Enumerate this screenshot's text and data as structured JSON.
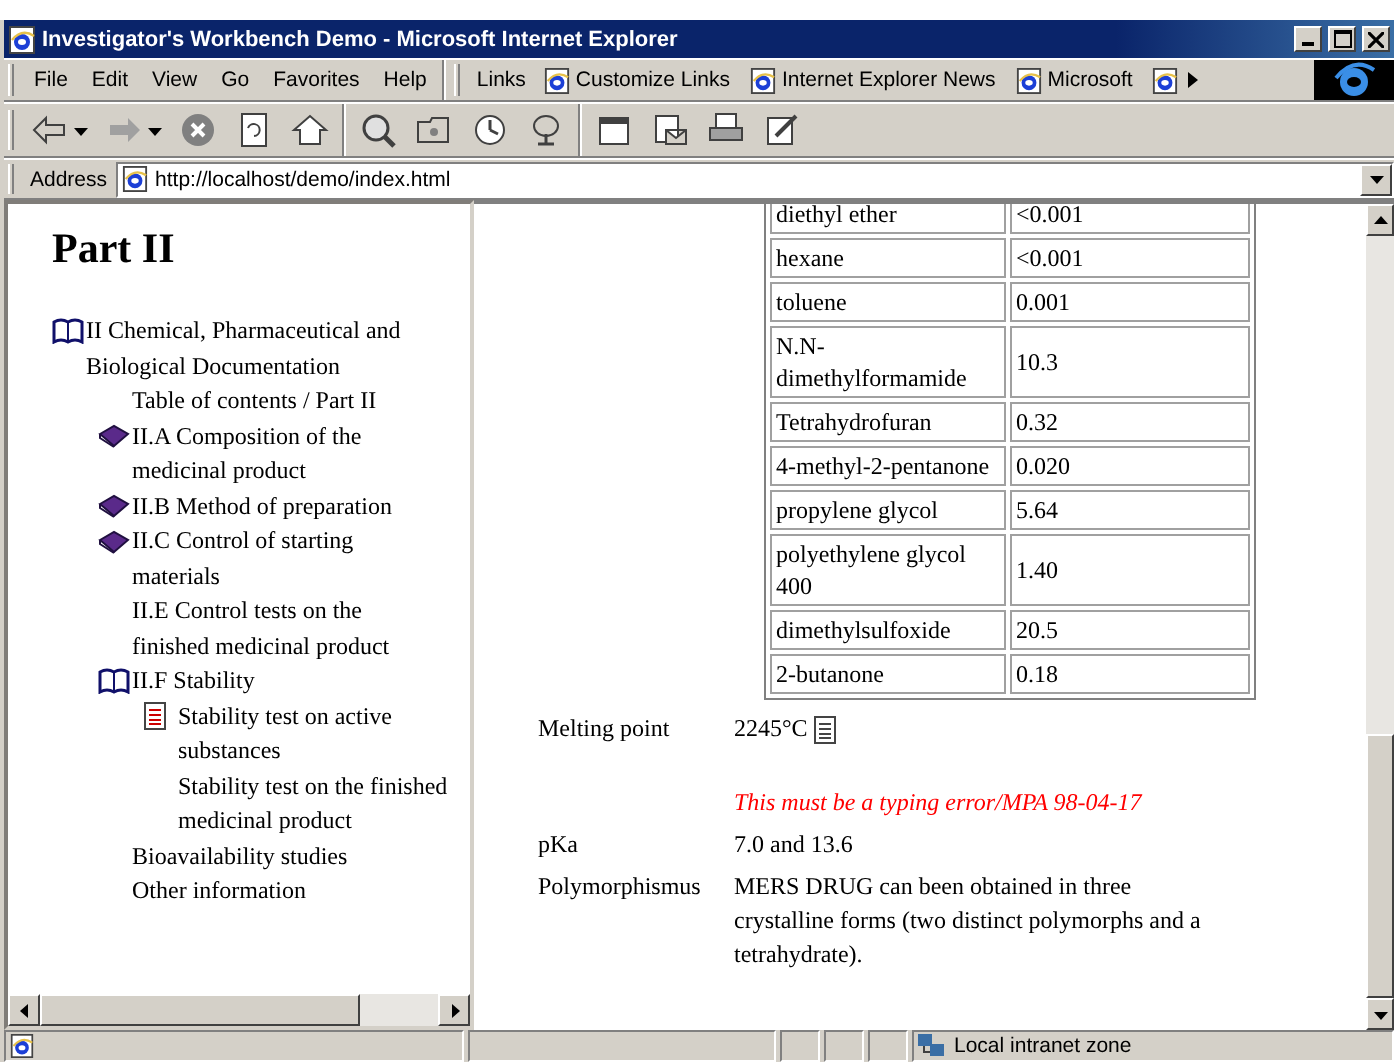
{
  "window": {
    "title": "Investigator's Workbench Demo - Microsoft Internet Explorer"
  },
  "menu": [
    "File",
    "Edit",
    "View",
    "Go",
    "Favorites",
    "Help"
  ],
  "links": {
    "label": "Links",
    "items": [
      "Customize Links",
      "Internet Explorer News",
      "Microsoft"
    ]
  },
  "address": {
    "label": "Address",
    "value": "http://localhost/demo/index.html"
  },
  "sidebar": {
    "heading": "Part II",
    "items": [
      {
        "kind": "open-book",
        "label": "II Chemical, Pharmaceutical and Biological Documentation",
        "children": [
          {
            "kind": "plain",
            "label": "Table of contents / Part II"
          },
          {
            "kind": "closed-book",
            "label": "II.A Composition of the medicinal product"
          },
          {
            "kind": "closed-book",
            "label": "II.B Method of preparation"
          },
          {
            "kind": "closed-book",
            "label": "II.C Control of starting materials"
          },
          {
            "kind": "plain",
            "label": "II.E Control tests on the finished medicinal product"
          },
          {
            "kind": "open-book",
            "label": "II.F Stability",
            "children": [
              {
                "kind": "document",
                "label": "Stability test on active substances"
              },
              {
                "kind": "plain",
                "label": "Stability test on the finished medicinal product"
              }
            ]
          },
          {
            "kind": "plain",
            "label": "Bioavailability studies"
          },
          {
            "kind": "plain",
            "label": "Other information"
          }
        ]
      }
    ]
  },
  "table": {
    "rows": [
      [
        "diethyl ether",
        "<0.001"
      ],
      [
        "hexane",
        "<0.001"
      ],
      [
        "toluene",
        "0.001"
      ],
      [
        "N.N-dimethylformamide",
        "10.3"
      ],
      [
        "Tetrahydrofuran",
        "0.32"
      ],
      [
        "4-methyl-2-pentanone",
        "0.020"
      ],
      [
        "propylene glycol",
        "5.64"
      ],
      [
        "polyethylene glycol 400",
        "1.40"
      ],
      [
        "dimethylsulfoxide",
        "20.5"
      ],
      [
        "2-butanone",
        "0.18"
      ]
    ]
  },
  "properties": [
    {
      "label": "Melting point",
      "value": "2245°C",
      "note": true
    },
    {
      "kind": "comment",
      "value": "This must be a typing error/MPA 98-04-17"
    },
    {
      "label": "pKa",
      "value": "7.0 and 13.6",
      "note": false
    },
    {
      "label": "Polymorphismus",
      "value": "MERS DRUG can been obtained in three crystalline forms (two distinct polymorphs and a tetrahydrate).",
      "note": false
    }
  ],
  "status_bar": {
    "zone": "Local intranet zone"
  }
}
